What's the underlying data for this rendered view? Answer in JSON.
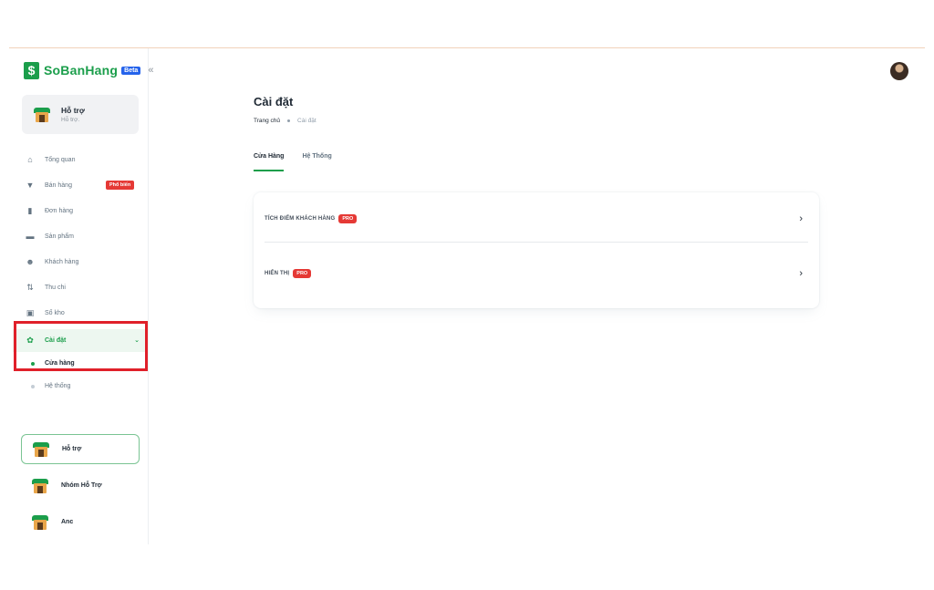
{
  "brand": {
    "name": "SoBanHang",
    "badge": "Beta",
    "logo_glyph": "$",
    "collapse_icon": "«"
  },
  "account": {
    "name": "Hỗ trợ",
    "subtitle": "Hỗ trợ."
  },
  "nav": {
    "items": [
      {
        "label": "Tổng quan",
        "icon": "home-icon",
        "glyph": "⌂"
      },
      {
        "label": "Bán hàng",
        "icon": "cart-icon",
        "glyph": "▼",
        "badge": "Phổ biến"
      },
      {
        "label": "Đơn hàng",
        "icon": "document-icon",
        "glyph": "▮"
      },
      {
        "label": "Sản phẩm",
        "icon": "box-icon",
        "glyph": "▬"
      },
      {
        "label": "Khách hàng",
        "icon": "users-icon",
        "glyph": "☻"
      },
      {
        "label": "Thu chi",
        "icon": "transfer-icon",
        "glyph": "⇅"
      },
      {
        "label": "Sổ kho",
        "icon": "warehouse-icon",
        "glyph": "▣"
      }
    ],
    "settings": {
      "label": "Cài đặt",
      "icon": "gear-icon",
      "glyph": "✿",
      "chevron": "⌄"
    },
    "settings_sub": [
      {
        "label": "Cửa hàng",
        "active": true
      },
      {
        "label": "Hệ thống",
        "active": false
      }
    ]
  },
  "stores": [
    {
      "name": "Hỗ trợ",
      "selected": true
    },
    {
      "name": "Nhóm Hỗ Trợ",
      "selected": false
    },
    {
      "name": "Anc",
      "selected": false
    }
  ],
  "page": {
    "title": "Cài đặt",
    "breadcrumb": {
      "home": "Trang chủ",
      "current": "Cài đặt"
    }
  },
  "tabs": [
    {
      "label": "Cửa Hàng",
      "active": true
    },
    {
      "label": "Hệ Thống",
      "active": false
    }
  ],
  "settings_rows": [
    {
      "label": "TÍCH ĐIỂM KHÁCH HÀNG",
      "badge": "PRO",
      "chevron": "›"
    },
    {
      "label": "HIỂN THỊ",
      "badge": "PRO",
      "chevron": "›"
    }
  ],
  "colors": {
    "brand": "#1b9e4b",
    "beta": "#2563eb",
    "pro_badge": "#e53935",
    "highlight_frame": "#e0202a"
  }
}
